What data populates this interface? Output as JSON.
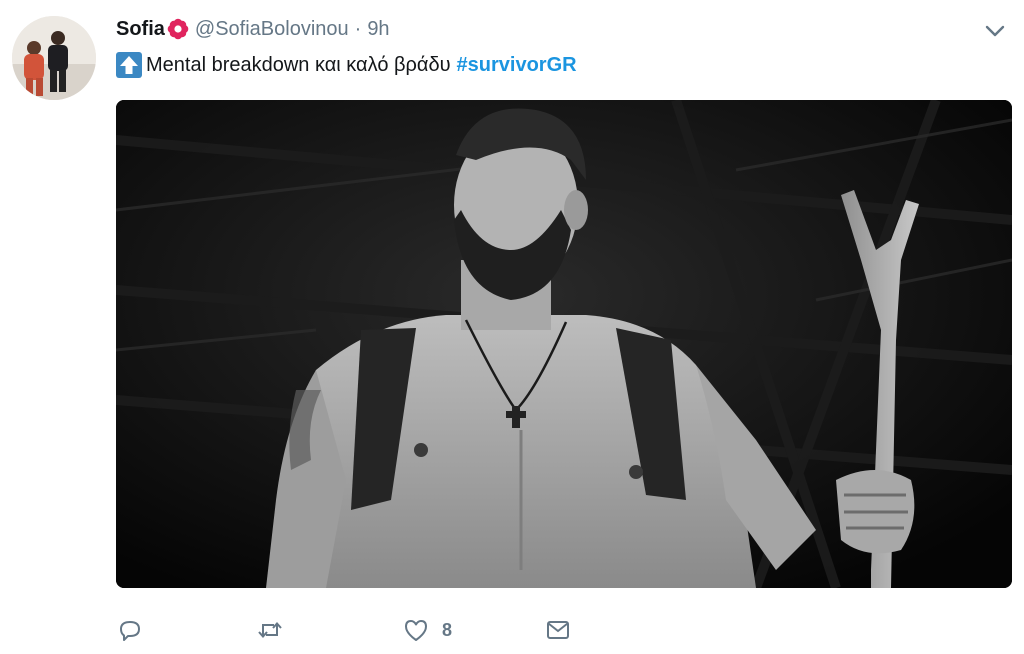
{
  "tweet": {
    "display_name": "Sofia",
    "handle": "@SofiaBolovinou",
    "separator": "·",
    "time": "9h",
    "text": "Mental breakdown και καλό βράδυ",
    "hashtag": "#survivorGR",
    "emoji": "up-arrow-emoji"
  },
  "actions": {
    "reply_icon": "reply-icon",
    "retweet_icon": "retweet-icon",
    "like_icon": "heart-icon",
    "like_count": "8",
    "message_icon": "envelope-icon"
  },
  "colors": {
    "link": "#1b95e0",
    "muted": "#657786",
    "text": "#14171a",
    "icon": "#657786"
  }
}
